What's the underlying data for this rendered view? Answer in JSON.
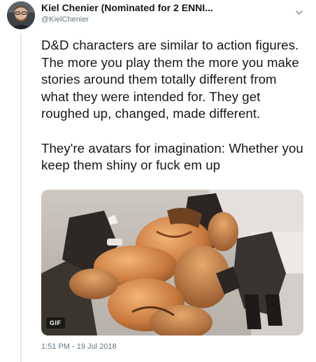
{
  "author": {
    "display_name": "Kiel Chenier (Nominated for 2 ENNI...",
    "handle": "@KielChenier"
  },
  "icons": {
    "menu": "chevron-down-icon"
  },
  "tweet": {
    "text": "D&D characters are similar to action figures. The more you play them the more you make stories around them totally different from what they were intended for. They get roughed up, changed, made different.\n\nThey're avatars for imagination: Whether you keep them shiny or fuck em up",
    "media_badge": "GIF",
    "timestamp": "1:51 PM - 19 Jul 2018"
  },
  "colors": {
    "text_primary": "#14171a",
    "text_secondary": "#657786",
    "rule": "#e1e8ed"
  }
}
